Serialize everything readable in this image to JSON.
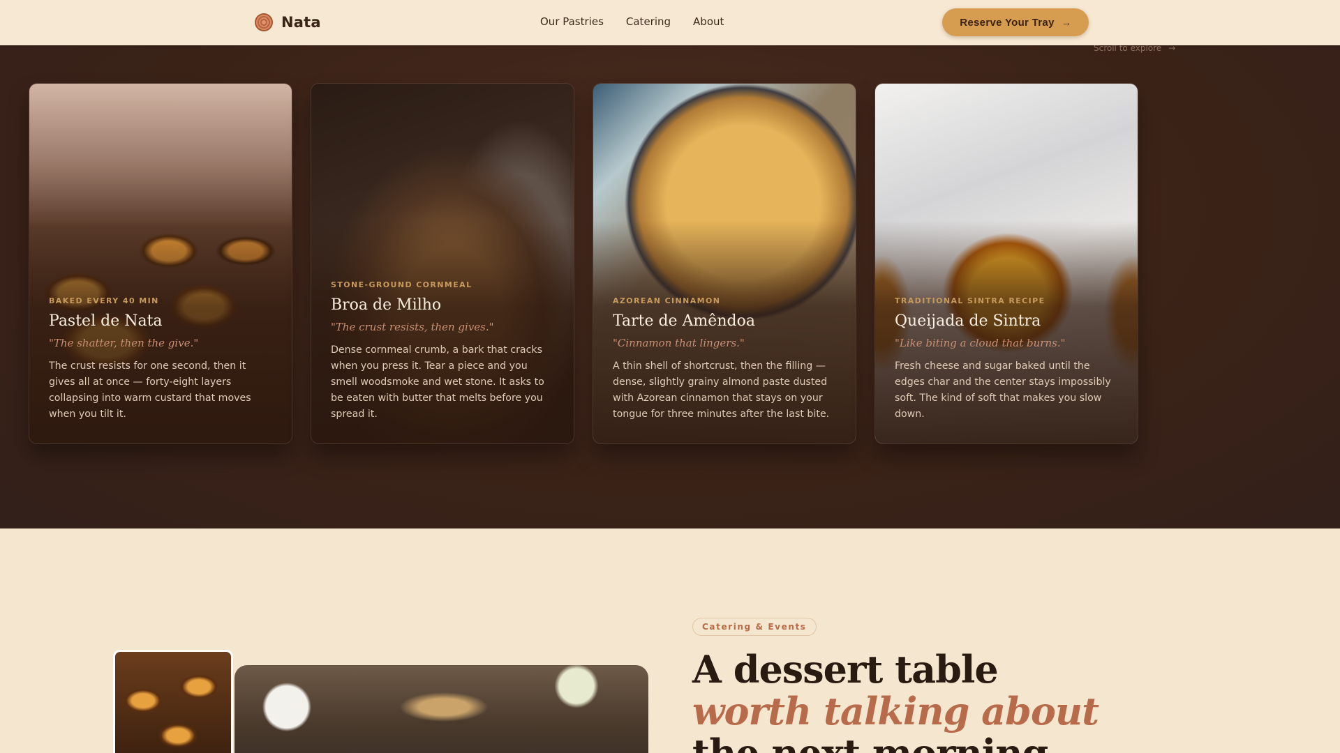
{
  "nav": {
    "brand": "Nata",
    "links": [
      "Our Pastries",
      "Catering",
      "About"
    ],
    "cta_label": "Reserve Your Tray",
    "cta_icon": "arrow-right-icon"
  },
  "pastries_section": {
    "scroll_hint": "Scroll to explore",
    "scroll_icon": "arrow-right-icon",
    "cards": [
      {
        "eyebrow": "Baked every 40 min",
        "title": "Pastel de Nata",
        "quote": "\"The shatter, then the give.\"",
        "description": "The crust resists for one second, then it gives all at once — forty-eight layers collapsing into warm custard that moves when you tilt it."
      },
      {
        "eyebrow": "Stone-ground cornmeal",
        "title": "Broa de Milho",
        "quote": "\"The crust resists, then gives.\"",
        "description": "Dense cornmeal crumb, a bark that cracks when you press it. Tear a piece and you smell woodsmoke and wet stone. It asks to be eaten with butter that melts before you spread it."
      },
      {
        "eyebrow": "Azorean cinnamon",
        "title": "Tarte de Amêndoa",
        "quote": "\"Cinnamon that lingers.\"",
        "description": "A thin shell of shortcrust, then the filling — dense, slightly grainy almond paste dusted with Azorean cinnamon that stays on your tongue for three minutes after the last bite."
      },
      {
        "eyebrow": "Traditional Sintra recipe",
        "title": "Queijada de Sintra",
        "quote": "\"Like biting a cloud that burns.\"",
        "description": "Fresh cheese and sugar baked until the edges char and the center stays impossibly soft. The kind of soft that makes you slow down."
      }
    ]
  },
  "catering": {
    "tag": "Catering & Events",
    "headline_line1": "A dessert table",
    "headline_line2": "worth talking about",
    "headline_line3": "the next morning"
  }
}
